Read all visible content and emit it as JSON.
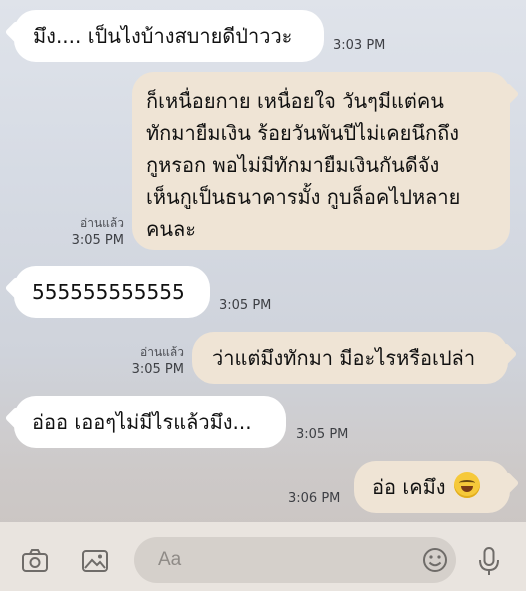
{
  "messages": [
    {
      "side": "in",
      "text": "มึง.... เป็นไงบ้างสบายดีป่าววะ",
      "time": "3:03 PM"
    },
    {
      "side": "out",
      "lines": [
        "ก็เหนื่อยกาย เหนื่อยใจ วันๆมีแต่คน",
        "ทักมายืมเงิน ร้อยวันพันปีไม่เคยนึกถึง",
        "กูหรอก พอไม่มีทักมายืมเงินกันดีจัง",
        "เห็นกูเป็นธนาคารมั้ง กูบล็อคไปหลาย",
        "คนละ"
      ],
      "read": "อ่านแล้ว",
      "time": "3:05 PM"
    },
    {
      "side": "in",
      "text": "555555555555",
      "time": "3:05 PM"
    },
    {
      "side": "out",
      "text": "ว่าแต่มึงทักมา มีอะไรหรือเปล่า",
      "read": "อ่านแล้ว",
      "time": "3:05 PM"
    },
    {
      "side": "in",
      "text": "อ่ออ เออๆไม่มีไรแล้วมึง...",
      "time": "3:05 PM"
    },
    {
      "side": "out",
      "text": "อ่อ เคมึง",
      "emoji": "rolling-on-floor-laughing",
      "time": "3:06 PM"
    }
  ],
  "composer": {
    "placeholder": "Aa",
    "icons": [
      "camera-icon",
      "image-icon",
      "emoji-icon",
      "microphone-icon"
    ]
  },
  "colors": {
    "incoming_bubble": "#ffffff",
    "outgoing_bubble": "#efe4d5",
    "input_bar": "#e9e4df"
  }
}
